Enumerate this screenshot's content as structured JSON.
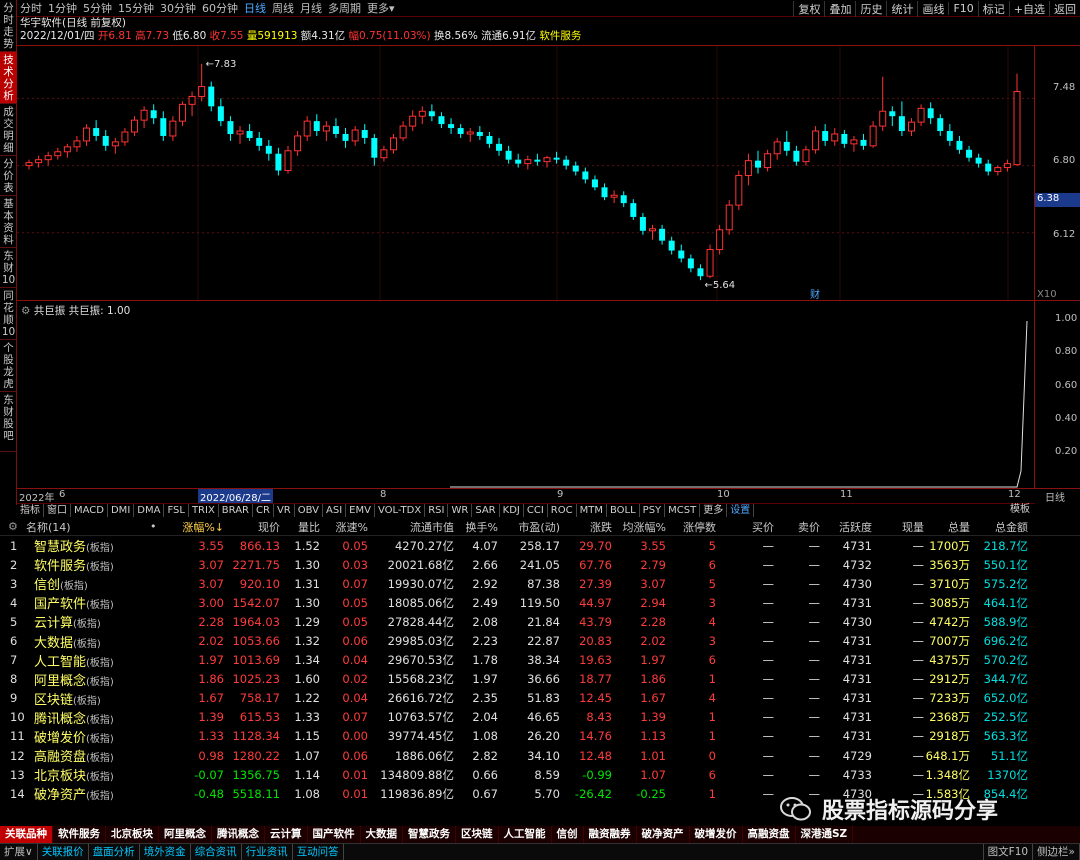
{
  "left_tabs": [
    "分时走势",
    "技术分析",
    "成交明细",
    "分价表",
    "基本资料",
    "东财10",
    "同花顺10",
    "个股龙虎",
    "东财股吧"
  ],
  "period_tabs": [
    "分时",
    "1分钟",
    "5分钟",
    "15分钟",
    "30分钟",
    "60分钟",
    "日线",
    "周线",
    "月线",
    "多周期",
    "更多▾"
  ],
  "active_period": "日线",
  "toolbar_right": [
    "复权",
    "叠加",
    "历史",
    "统计",
    "画线",
    "F10",
    "标记",
    "+自选",
    "返回"
  ],
  "stock": {
    "title": "华宇软件(日线 前复权)",
    "date": "2022/12/01/四",
    "open_label": "开",
    "open": "6.81",
    "high_label": "高",
    "high": "7.73",
    "low_label": "低",
    "low": "6.80",
    "close_label": "收",
    "close": "7.55",
    "vol_label": "量",
    "vol": "591913",
    "amt_label": "额",
    "amt": "4.31亿",
    "chg_label": "幅",
    "chg": "0.75(11.03%)",
    "turn_label": "换",
    "turn": "8.56%",
    "float_label": "流通",
    "float": "6.91亿",
    "sector": "软件服务"
  },
  "price_axis": [
    "7.48",
    "6.80",
    "6.38",
    "6.12"
  ],
  "marks": {
    "high": "7.83",
    "low": "5.64",
    "fin": "财",
    "x10": "X10"
  },
  "indicator": {
    "name": "共巨振",
    "label": "共巨振: 1.00",
    "axis": [
      "1.00",
      "0.80",
      "0.60",
      "0.40",
      "0.20"
    ]
  },
  "date_axis": [
    "2022年",
    "6",
    "2022/06/28/二",
    "8",
    "9",
    "10",
    "11",
    "12",
    "日线"
  ],
  "indicator_tabs": [
    "指标",
    "窗口",
    "MACD",
    "DMI",
    "DMA",
    "FSL",
    "TRIX",
    "BRAR",
    "CR",
    "VR",
    "OBV",
    "ASI",
    "EMV",
    "VOL-TDX",
    "RSI",
    "WR",
    "SAR",
    "KDJ",
    "CCI",
    "ROC",
    "MTM",
    "BOLL",
    "PSY",
    "MCST",
    "更多",
    "设置"
  ],
  "template_label": "模板",
  "chart_data": {
    "type": "candlestick",
    "y_range": [
      5.5,
      7.95
    ],
    "candles": [
      [
        6.8,
        6.86,
        6.76,
        6.83
      ],
      [
        6.83,
        6.9,
        6.78,
        6.86
      ],
      [
        6.86,
        6.94,
        6.8,
        6.9
      ],
      [
        6.9,
        6.98,
        6.86,
        6.94
      ],
      [
        6.94,
        7.02,
        6.88,
        6.99
      ],
      [
        6.99,
        7.1,
        6.94,
        7.05
      ],
      [
        7.05,
        7.22,
        7.0,
        7.18
      ],
      [
        7.18,
        7.26,
        7.05,
        7.1
      ],
      [
        7.1,
        7.16,
        6.95,
        7.0
      ],
      [
        7.0,
        7.08,
        6.92,
        7.04
      ],
      [
        7.04,
        7.18,
        7.0,
        7.14
      ],
      [
        7.14,
        7.3,
        7.1,
        7.26
      ],
      [
        7.26,
        7.4,
        7.18,
        7.36
      ],
      [
        7.36,
        7.42,
        7.22,
        7.28
      ],
      [
        7.28,
        7.35,
        7.05,
        7.1
      ],
      [
        7.1,
        7.3,
        7.05,
        7.25
      ],
      [
        7.25,
        7.45,
        7.2,
        7.42
      ],
      [
        7.42,
        7.55,
        7.3,
        7.5
      ],
      [
        7.5,
        7.83,
        7.45,
        7.6
      ],
      [
        7.6,
        7.65,
        7.35,
        7.4
      ],
      [
        7.4,
        7.48,
        7.2,
        7.25
      ],
      [
        7.25,
        7.3,
        7.05,
        7.12
      ],
      [
        7.12,
        7.2,
        7.02,
        7.15
      ],
      [
        7.15,
        7.22,
        7.05,
        7.08
      ],
      [
        7.08,
        7.14,
        6.95,
        7.0
      ],
      [
        7.0,
        7.06,
        6.85,
        6.92
      ],
      [
        6.92,
        6.98,
        6.7,
        6.75
      ],
      [
        6.75,
        7.0,
        6.72,
        6.95
      ],
      [
        6.95,
        7.15,
        6.9,
        7.1
      ],
      [
        7.1,
        7.3,
        7.05,
        7.25
      ],
      [
        7.25,
        7.32,
        7.1,
        7.15
      ],
      [
        7.15,
        7.25,
        7.05,
        7.2
      ],
      [
        7.2,
        7.28,
        7.08,
        7.12
      ],
      [
        7.12,
        7.18,
        6.98,
        7.05
      ],
      [
        7.05,
        7.2,
        7.0,
        7.16
      ],
      [
        7.16,
        7.22,
        7.02,
        7.08
      ],
      [
        7.08,
        7.12,
        6.8,
        6.88
      ],
      [
        6.88,
        7.0,
        6.84,
        6.96
      ],
      [
        6.96,
        7.12,
        6.92,
        7.08
      ],
      [
        7.08,
        7.25,
        7.05,
        7.2
      ],
      [
        7.2,
        7.36,
        7.15,
        7.3
      ],
      [
        7.3,
        7.4,
        7.22,
        7.35
      ],
      [
        7.35,
        7.42,
        7.25,
        7.3
      ],
      [
        7.3,
        7.34,
        7.18,
        7.22
      ],
      [
        7.22,
        7.28,
        7.12,
        7.18
      ],
      [
        7.18,
        7.22,
        7.08,
        7.12
      ],
      [
        7.12,
        7.18,
        7.04,
        7.14
      ],
      [
        7.14,
        7.2,
        7.06,
        7.1
      ],
      [
        7.1,
        7.14,
        6.98,
        7.02
      ],
      [
        7.02,
        7.08,
        6.9,
        6.95
      ],
      [
        6.95,
        7.0,
        6.82,
        6.86
      ],
      [
        6.86,
        6.92,
        6.78,
        6.82
      ],
      [
        6.82,
        6.9,
        6.76,
        6.86
      ],
      [
        6.86,
        6.92,
        6.8,
        6.84
      ],
      [
        6.84,
        6.9,
        6.78,
        6.88
      ],
      [
        6.88,
        6.94,
        6.82,
        6.86
      ],
      [
        6.86,
        6.9,
        6.76,
        6.8
      ],
      [
        6.8,
        6.84,
        6.7,
        6.74
      ],
      [
        6.74,
        6.78,
        6.62,
        6.66
      ],
      [
        6.66,
        6.7,
        6.55,
        6.58
      ],
      [
        6.58,
        6.62,
        6.45,
        6.48
      ],
      [
        6.48,
        6.55,
        6.42,
        6.5
      ],
      [
        6.5,
        6.54,
        6.38,
        6.42
      ],
      [
        6.42,
        6.46,
        6.25,
        6.28
      ],
      [
        6.28,
        6.32,
        6.1,
        6.14
      ],
      [
        6.14,
        6.2,
        6.05,
        6.16
      ],
      [
        6.16,
        6.2,
        6.0,
        6.04
      ],
      [
        6.04,
        6.08,
        5.9,
        5.94
      ],
      [
        5.94,
        6.0,
        5.82,
        5.86
      ],
      [
        5.86,
        5.9,
        5.72,
        5.76
      ],
      [
        5.76,
        5.8,
        5.64,
        5.68
      ],
      [
        5.68,
        6.0,
        5.66,
        5.95
      ],
      [
        5.95,
        6.2,
        5.9,
        6.15
      ],
      [
        6.15,
        6.45,
        6.1,
        6.4
      ],
      [
        6.4,
        6.75,
        6.35,
        6.7
      ],
      [
        6.7,
        6.92,
        6.6,
        6.85
      ],
      [
        6.85,
        6.95,
        6.72,
        6.78
      ],
      [
        6.78,
        6.96,
        6.74,
        6.92
      ],
      [
        6.92,
        7.08,
        6.86,
        7.04
      ],
      [
        7.04,
        7.15,
        6.9,
        6.95
      ],
      [
        6.95,
        7.0,
        6.8,
        6.84
      ],
      [
        6.84,
        7.0,
        6.8,
        6.96
      ],
      [
        6.96,
        7.2,
        6.92,
        7.15
      ],
      [
        7.15,
        7.22,
        7.0,
        7.05
      ],
      [
        7.05,
        7.18,
        7.0,
        7.12
      ],
      [
        7.12,
        7.16,
        6.98,
        7.02
      ],
      [
        7.02,
        7.1,
        6.94,
        7.06
      ],
      [
        7.06,
        7.12,
        6.96,
        7.0
      ],
      [
        7.0,
        7.25,
        6.98,
        7.2
      ],
      [
        7.2,
        7.7,
        7.15,
        7.35
      ],
      [
        7.35,
        7.4,
        7.2,
        7.3
      ],
      [
        7.3,
        7.45,
        7.1,
        7.15
      ],
      [
        7.15,
        7.28,
        7.1,
        7.24
      ],
      [
        7.24,
        7.42,
        7.2,
        7.38
      ],
      [
        7.38,
        7.44,
        7.22,
        7.28
      ],
      [
        7.28,
        7.32,
        7.1,
        7.15
      ],
      [
        7.15,
        7.22,
        7.0,
        7.05
      ],
      [
        7.05,
        7.1,
        6.92,
        6.96
      ],
      [
        6.96,
        7.0,
        6.84,
        6.88
      ],
      [
        6.88,
        6.92,
        6.78,
        6.82
      ],
      [
        6.82,
        6.86,
        6.7,
        6.74
      ],
      [
        6.74,
        6.8,
        6.7,
        6.78
      ],
      [
        6.78,
        6.86,
        6.74,
        6.82
      ],
      [
        6.81,
        7.73,
        6.8,
        7.55
      ]
    ]
  },
  "table": {
    "headers": [
      "",
      "名称(14)",
      "•",
      "涨幅%↓",
      "现价",
      "量比",
      "涨速%",
      "流通市值",
      "换手%",
      "市盈(动)",
      "涨跌",
      "均涨幅%",
      "涨停数",
      "买价",
      "卖价",
      "活跃度",
      "现量",
      "总量",
      "总金额"
    ],
    "rows": [
      [
        "1",
        "智慧政务",
        "(板指)",
        "3.55",
        "866.13",
        "1.52",
        "0.05",
        "4270.27亿",
        "4.07",
        "258.17",
        "29.70",
        "3.55",
        "5",
        "—",
        "—",
        "4731",
        "—",
        "1700万",
        "218.7亿"
      ],
      [
        "2",
        "软件服务",
        "(板指)",
        "3.07",
        "2271.75",
        "1.30",
        "0.03",
        "20021.68亿",
        "2.66",
        "241.05",
        "67.76",
        "2.79",
        "6",
        "—",
        "—",
        "4732",
        "—",
        "3563万",
        "550.1亿"
      ],
      [
        "3",
        "信创",
        "(板指)",
        "3.07",
        "920.10",
        "1.31",
        "0.07",
        "19930.07亿",
        "2.92",
        "87.38",
        "27.39",
        "3.07",
        "5",
        "—",
        "—",
        "4730",
        "—",
        "3710万",
        "575.2亿"
      ],
      [
        "4",
        "国产软件",
        "(板指)",
        "3.00",
        "1542.07",
        "1.30",
        "0.05",
        "18085.06亿",
        "2.49",
        "119.50",
        "44.97",
        "2.94",
        "3",
        "—",
        "—",
        "4731",
        "—",
        "3085万",
        "464.1亿"
      ],
      [
        "5",
        "云计算",
        "(板指)",
        "2.28",
        "1964.03",
        "1.29",
        "0.05",
        "27828.44亿",
        "2.08",
        "21.84",
        "43.79",
        "2.28",
        "4",
        "—",
        "—",
        "4730",
        "—",
        "4742万",
        "588.9亿"
      ],
      [
        "6",
        "大数据",
        "(板指)",
        "2.02",
        "1053.66",
        "1.32",
        "0.06",
        "29985.03亿",
        "2.23",
        "22.87",
        "20.83",
        "2.02",
        "3",
        "—",
        "—",
        "4731",
        "—",
        "7007万",
        "696.2亿"
      ],
      [
        "7",
        "人工智能",
        "(板指)",
        "1.97",
        "1013.69",
        "1.34",
        "0.04",
        "29670.53亿",
        "1.78",
        "38.34",
        "19.63",
        "1.97",
        "6",
        "—",
        "—",
        "4731",
        "—",
        "4375万",
        "570.2亿"
      ],
      [
        "8",
        "阿里概念",
        "(板指)",
        "1.86",
        "1025.23",
        "1.60",
        "0.02",
        "15568.23亿",
        "1.97",
        "36.66",
        "18.77",
        "1.86",
        "1",
        "—",
        "—",
        "4731",
        "—",
        "2912万",
        "344.7亿"
      ],
      [
        "9",
        "区块链",
        "(板指)",
        "1.67",
        "758.17",
        "1.22",
        "0.04",
        "26616.72亿",
        "2.35",
        "51.83",
        "12.45",
        "1.67",
        "4",
        "—",
        "—",
        "4731",
        "—",
        "7233万",
        "652.0亿"
      ],
      [
        "10",
        "腾讯概念",
        "(板指)",
        "1.39",
        "615.53",
        "1.33",
        "0.07",
        "10763.57亿",
        "2.04",
        "46.65",
        "8.43",
        "1.39",
        "1",
        "—",
        "—",
        "4731",
        "—",
        "2368万",
        "252.5亿"
      ],
      [
        "11",
        "破增发价",
        "(板指)",
        "1.33",
        "1128.34",
        "1.15",
        "0.00",
        "39774.45亿",
        "1.08",
        "26.20",
        "14.76",
        "1.13",
        "1",
        "—",
        "—",
        "4731",
        "—",
        "2918万",
        "563.3亿"
      ],
      [
        "12",
        "高融资盘",
        "(板指)",
        "0.98",
        "1280.22",
        "1.07",
        "0.06",
        "1886.06亿",
        "2.82",
        "34.10",
        "12.48",
        "1.01",
        "0",
        "—",
        "—",
        "4729",
        "—",
        "648.1万",
        "51.1亿"
      ],
      [
        "13",
        "北京板块",
        "(板指)",
        "-0.07",
        "1356.75",
        "1.14",
        "0.01",
        "134809.88亿",
        "0.66",
        "8.59",
        "-0.99",
        "1.07",
        "6",
        "—",
        "—",
        "4733",
        "—",
        "1.348亿",
        "1370亿"
      ],
      [
        "14",
        "破净资产",
        "(板指)",
        "-0.48",
        "5518.11",
        "1.08",
        "0.01",
        "119836.89亿",
        "0.67",
        "5.70",
        "-26.42",
        "-0.25",
        "1",
        "—",
        "—",
        "4730",
        "—",
        "1.583亿",
        "854.4亿"
      ]
    ]
  },
  "bottom_tabs": [
    "关联品种",
    "软件服务",
    "北京板块",
    "阿里概念",
    "腾讯概念",
    "云计算",
    "国产软件",
    "大数据",
    "智慧政务",
    "区块链",
    "人工智能",
    "信创",
    "融资融券",
    "破净资产",
    "破增发价",
    "高融资盘",
    "深港通SZ"
  ],
  "status_tabs": [
    "扩展∨",
    "关联报价",
    "盘面分析",
    "境外资金",
    "综合资讯",
    "行业资讯",
    "互动问答"
  ],
  "status_right": [
    "图文F10",
    "侧边栏»"
  ],
  "watermark": "股票指标源码分享",
  "colors": {
    "up": "#ff3232",
    "down": "#00ffff",
    "bg": "#000000",
    "frame": "#8b1010",
    "indicator_line": "#e0e0e0"
  }
}
